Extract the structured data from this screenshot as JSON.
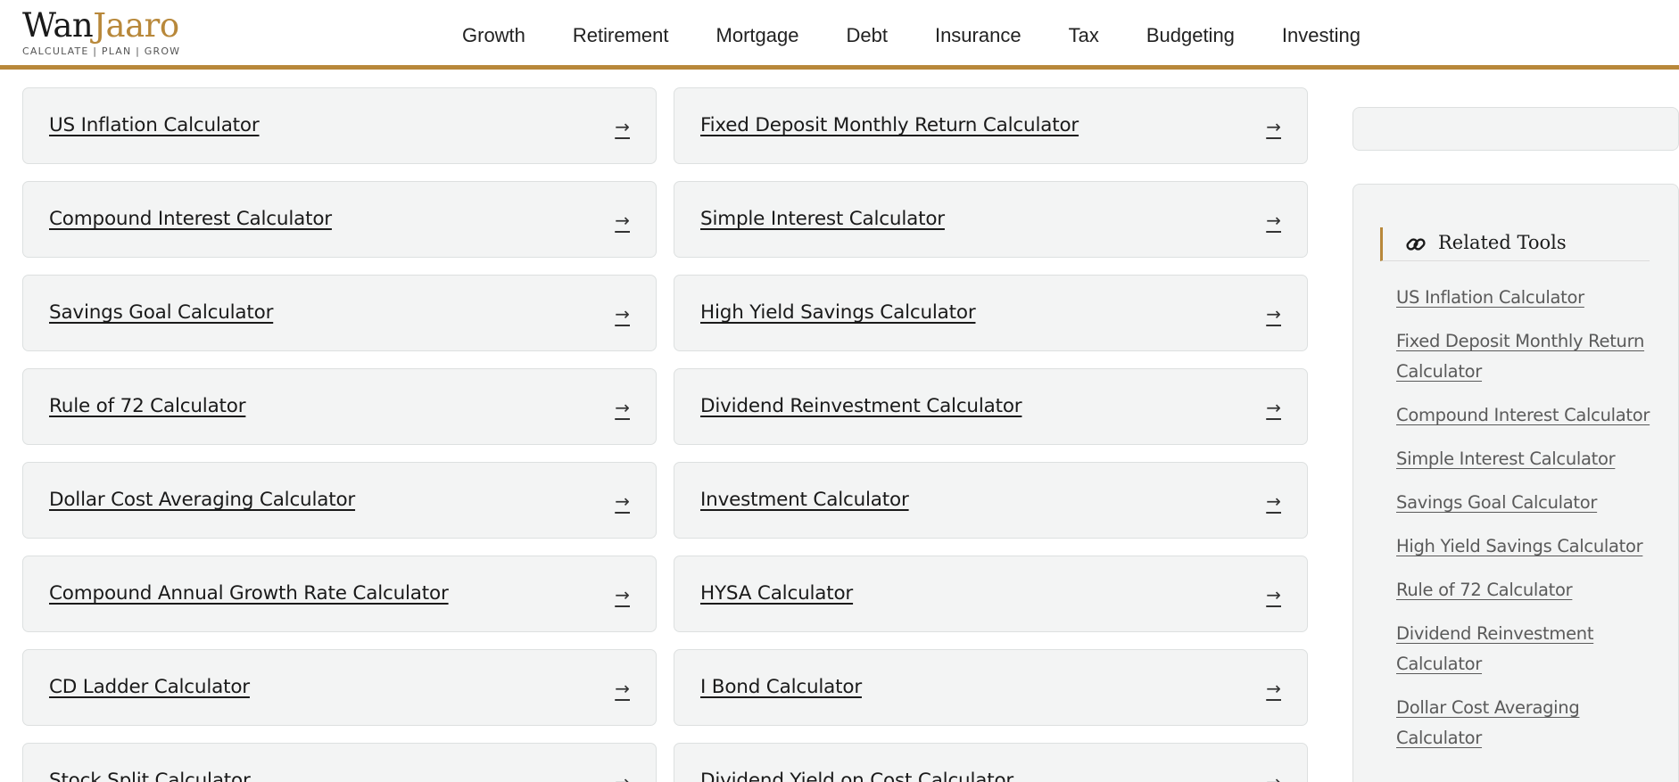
{
  "brand": {
    "name_part1": "Wan",
    "name_part2": "Jaaro",
    "tagline": "CALCULATE | PLAN | GROW",
    "accent_color": "#b8883a"
  },
  "nav": {
    "items": [
      "Growth",
      "Retirement",
      "Mortgage",
      "Debt",
      "Insurance",
      "Tax",
      "Budgeting",
      "Investing"
    ]
  },
  "calculators": {
    "arrow": "→",
    "items": [
      "US Inflation Calculator",
      "Fixed Deposit Monthly Return Calculator",
      "Compound Interest Calculator",
      "Simple Interest Calculator",
      "Savings Goal Calculator",
      "High Yield Savings Calculator",
      "Rule of 72 Calculator",
      "Dividend Reinvestment Calculator",
      "Dollar Cost Averaging Calculator",
      "Investment Calculator",
      "Compound Annual Growth Rate Calculator",
      "HYSA Calculator",
      "CD Ladder Calculator",
      "I Bond Calculator",
      "Stock Split Calculator",
      "Dividend Yield on Cost Calculator"
    ]
  },
  "related_tools": {
    "icon": "link-icon",
    "title": "Related Tools",
    "links": [
      "US Inflation Calculator",
      "Fixed Deposit Monthly Return Calculator",
      "Compound Interest Calculator",
      "Simple Interest Calculator",
      "Savings Goal Calculator",
      "High Yield Savings Calculator",
      "Rule of 72 Calculator",
      "Dividend Reinvestment Calculator",
      "Dollar Cost Averaging Calculator"
    ]
  }
}
